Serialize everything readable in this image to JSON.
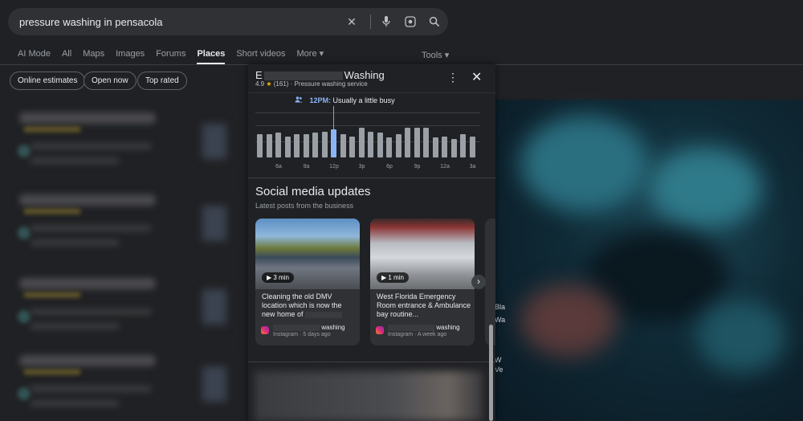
{
  "search": {
    "query": "pressure washing in pensacola"
  },
  "tabs": [
    {
      "label": "AI Mode"
    },
    {
      "label": "All"
    },
    {
      "label": "Maps"
    },
    {
      "label": "Images"
    },
    {
      "label": "Forums"
    },
    {
      "label": "Places"
    },
    {
      "label": "Short videos"
    },
    {
      "label": "More ▾"
    }
  ],
  "tools_label": "Tools ▾",
  "chips": [
    "Online estimates",
    "Open now",
    "Top rated"
  ],
  "panel": {
    "title_prefix": "E",
    "title_suffix": "Washing",
    "rating": "4.9",
    "review_count": "(161)",
    "category": "Pressure washing service",
    "busy_time": "12PM:",
    "busy_text": "Usually a little busy",
    "popular_times": {
      "values": [
        0.55,
        0.55,
        0.6,
        0.5,
        0.55,
        0.55,
        0.6,
        0.62,
        0.68,
        0.55,
        0.5,
        0.72,
        0.62,
        0.6,
        0.48,
        0.55,
        0.72,
        0.72,
        0.72,
        0.48,
        0.5,
        0.45,
        0.55,
        0.5
      ],
      "highlight_index": 8,
      "ticks": [
        "6a",
        "9a",
        "12p",
        "3p",
        "6p",
        "9p",
        "12a",
        "3a"
      ]
    },
    "social_title": "Social media updates",
    "social_subtitle": "Latest posts from the business",
    "posts": [
      {
        "duration": "3 min",
        "caption": "Cleaning the old DMV location which is now the new home of",
        "account_suffix": "washing",
        "meta": "Instagram · 5 days ago"
      },
      {
        "duration": "1 min",
        "caption": "West Florida Emergency Room entrance & Ambulance bay routine...",
        "account_suffix": "washing",
        "meta": "Instagram · A week ago"
      }
    ]
  },
  "map_labels": [
    "Bla",
    "Wa",
    "W",
    "Ve"
  ],
  "colors": {
    "accent": "#8ab4f8",
    "bar": "#9aa0a6",
    "star": "#fbbc04",
    "background": "#202124"
  }
}
